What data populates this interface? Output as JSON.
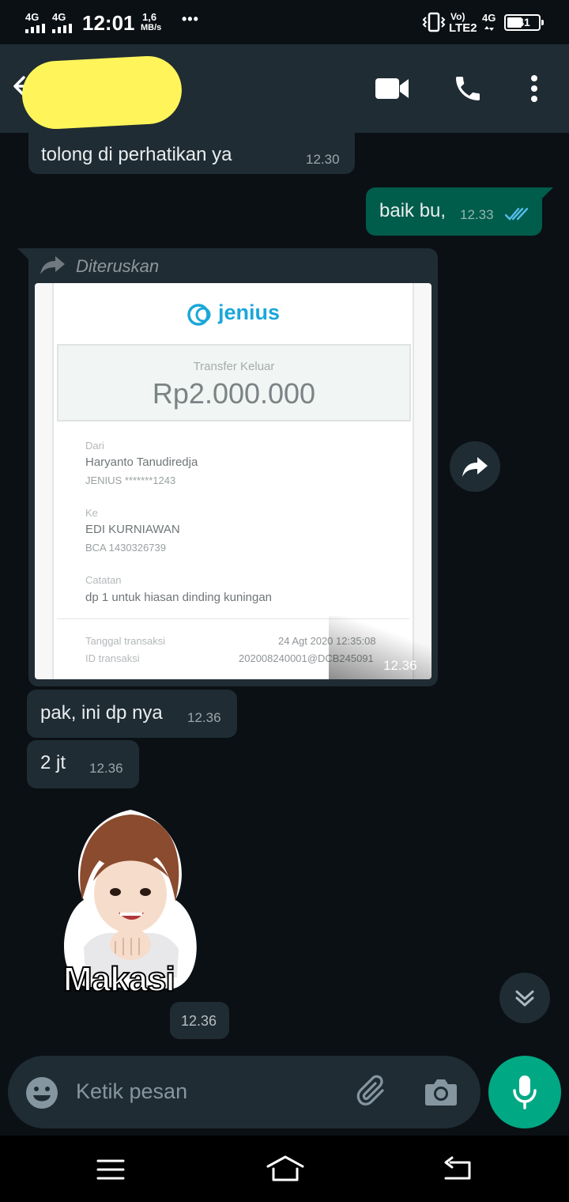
{
  "status_bar": {
    "sim1": "4G",
    "sim2": "4G",
    "time": "12:01",
    "speed_value": "1,6",
    "speed_unit": "MB/s",
    "more": "•••",
    "volte": "Vo)",
    "lte2": "LTE2",
    "net": "4G",
    "battery": "41"
  },
  "app_bar": {
    "icons": [
      "back-arrow-icon",
      "video-call-icon",
      "phone-icon",
      "more-vert-icon"
    ]
  },
  "messages": [
    {
      "text": "tolong di perhatikan ya",
      "time": "12.30",
      "direction": "in"
    },
    {
      "text": "baik bu,",
      "time": "12.33",
      "direction": "out",
      "status": "read"
    },
    {
      "text": "pak, ini dp nya",
      "time": "12.36",
      "direction": "in"
    },
    {
      "text": "2 jt",
      "time": "12.36",
      "direction": "in"
    }
  ],
  "forwarded": {
    "label": "Diteruskan",
    "time": "12.36",
    "receipt": {
      "brand": "jenius",
      "heading": "Transfer Keluar",
      "amount": "Rp2.000.000",
      "from_label": "Dari",
      "from_name": "Haryanto Tanudiredja",
      "from_account": "JENIUS *******1243",
      "to_label": "Ke",
      "to_name": "EDI KURNIAWAN",
      "to_account": "BCA 1430326739",
      "note_label": "Catatan",
      "note": "dp 1 untuk hiasan dinding kuningan",
      "date_label": "Tanggal transaksi",
      "date_value": "24 Agt 2020 12:35:08",
      "id_label": "ID transaksi",
      "id_value": "202008240001@DCB245091"
    }
  },
  "sticker": {
    "text": "Makasi",
    "time": "12.36"
  },
  "composer": {
    "placeholder": "Ketik pesan"
  },
  "colors": {
    "background": "#0b1014",
    "incoming": "#1f2c34",
    "outgoing": "#005c4b",
    "accent": "#00a884",
    "read_ticks": "#53bdeb",
    "jenius": "#1aa7d9"
  }
}
